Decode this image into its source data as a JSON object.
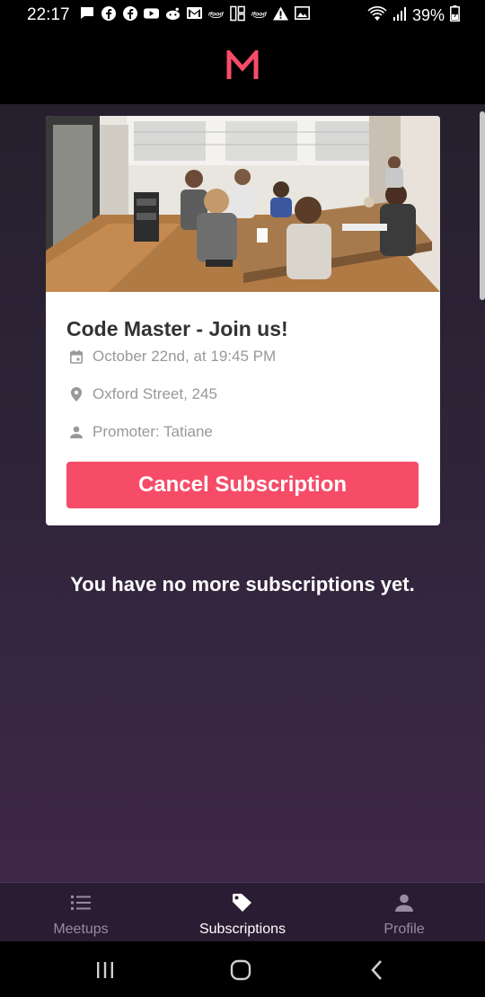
{
  "status_bar": {
    "time": "22:17",
    "battery": "39%",
    "notification_icons": [
      "message-icon",
      "facebook-icon",
      "facebook-icon",
      "youtube-icon",
      "reddit-icon",
      "gmail-icon",
      "ifood-icon",
      "screen-icon",
      "ifood-icon",
      "warning-icon",
      "gallery-icon"
    ]
  },
  "header": {
    "logo": "M",
    "logo_color": "#f64c68"
  },
  "meetup_card": {
    "title": "Code Master - Join us!",
    "date": "October 22nd, at 19:45 PM",
    "location": "Oxford Street, 245",
    "promoter": "Promoter: Tatiane",
    "cancel_label": "Cancel Subscription",
    "accent_color": "#f64c68"
  },
  "empty_message": "You have no more subscriptions yet.",
  "tabs": [
    {
      "label": "Meetups",
      "icon": "list-icon",
      "active": false
    },
    {
      "label": "Subscriptions",
      "icon": "tag-icon",
      "active": true
    },
    {
      "label": "Profile",
      "icon": "person-icon",
      "active": false
    }
  ]
}
